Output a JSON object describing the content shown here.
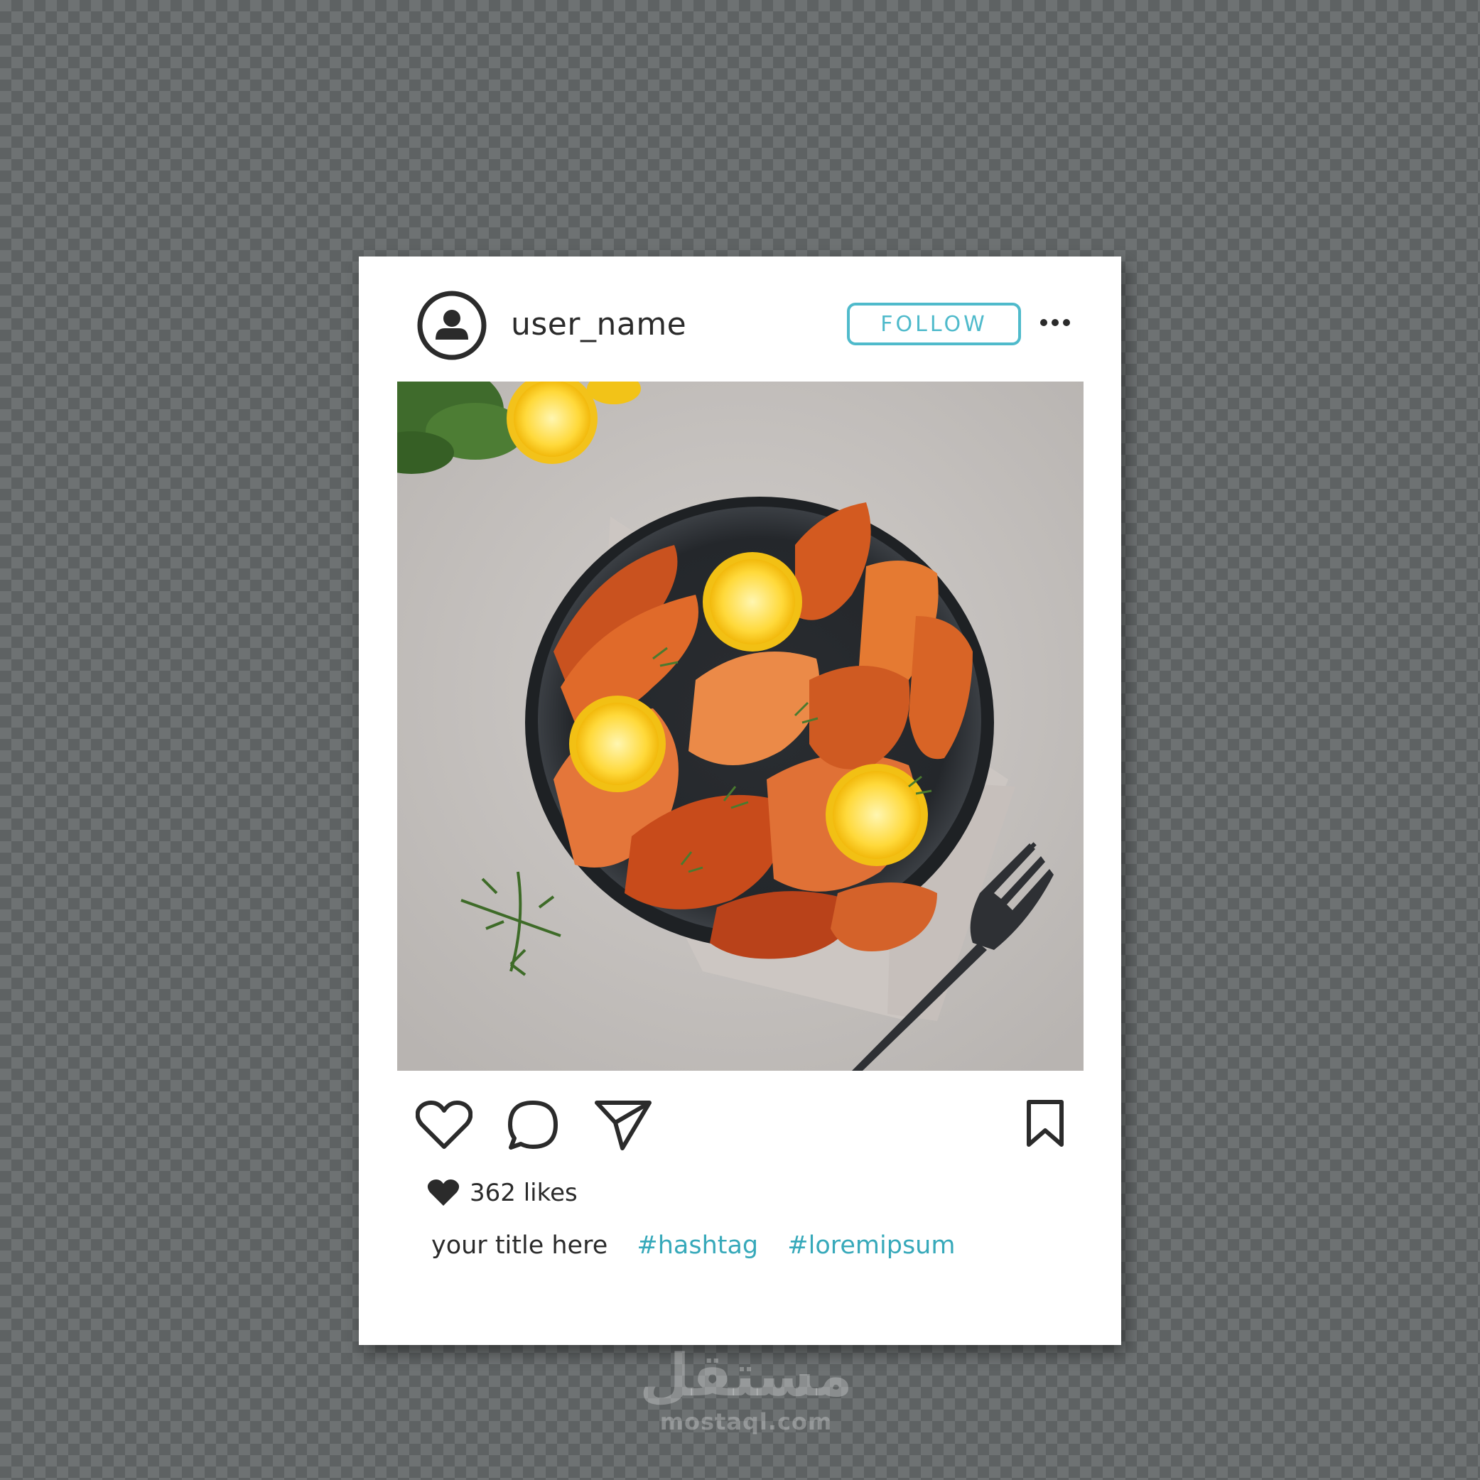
{
  "post": {
    "username": "user_name",
    "follow_label": "FOLLOW",
    "likes_text": "362 likes",
    "caption_title": "your title here",
    "hashtags": [
      "#hashtag",
      "#loremipsum"
    ]
  },
  "icons": {
    "avatar": "user-circle-icon",
    "more": "more-dots-icon",
    "like": "heart-outline-icon",
    "comment": "speech-bubble-icon",
    "share": "paper-plane-icon",
    "save": "bookmark-icon",
    "likes": "heart-filled-icon"
  },
  "watermark": {
    "arabic": "مستقل",
    "latin": "mostaql.com"
  },
  "colors": {
    "accent": "#4fbacb",
    "hashtag": "#37a9ba",
    "text": "#2b2b2b",
    "icon": "#2b2b2b",
    "background_checker_light": "#6e7273",
    "background_checker_dark": "#5e6263"
  },
  "photo": {
    "subject": "grilled shrimp with lemon slices in a dark plate"
  }
}
